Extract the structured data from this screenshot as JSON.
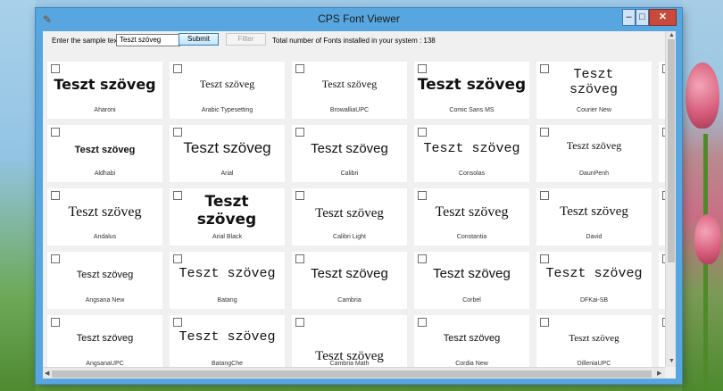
{
  "window": {
    "title": "CPS Font Viewer",
    "min_label": "0",
    "max_label": "1",
    "close_label": "r"
  },
  "toolbar": {
    "sample_label": "Enter the sample text :",
    "sample_value": "Teszt szöveg",
    "submit_label": "Submit",
    "filter_label": "Filter",
    "total_text": "Total number of Fonts installed in your system : 138"
  },
  "fonts": {
    "sample": "Teszt szöveg",
    "rows": [
      [
        {
          "name": "Aharoni"
        },
        {
          "name": "Arabic Typesetting"
        },
        {
          "name": "BrowalliaUPC"
        },
        {
          "name": "Comic Sans MS"
        },
        {
          "name": "Courier New"
        },
        {
          "name": ""
        }
      ],
      [
        {
          "name": "Aldhabi"
        },
        {
          "name": "Arial"
        },
        {
          "name": "Calibri"
        },
        {
          "name": "Consolas"
        },
        {
          "name": "DaunPenh"
        },
        {
          "name": ""
        }
      ],
      [
        {
          "name": "Andalus"
        },
        {
          "name": "Arial Black"
        },
        {
          "name": "Calibri Light"
        },
        {
          "name": "Constantia"
        },
        {
          "name": "David"
        },
        {
          "name": ""
        }
      ],
      [
        {
          "name": "Angsana New"
        },
        {
          "name": "Batang"
        },
        {
          "name": "Cambria"
        },
        {
          "name": "Corbel"
        },
        {
          "name": "DFKai-SB"
        },
        {
          "name": ""
        }
      ],
      [
        {
          "name": "AngsanaUPC"
        },
        {
          "name": "BatangChe"
        },
        {
          "name": "Cambria Math"
        },
        {
          "name": "Cordia New"
        },
        {
          "name": "DilleniaUPC"
        },
        {
          "name": ""
        }
      ]
    ]
  },
  "scroll": {
    "up": "▲",
    "down": "▼",
    "left": "◀",
    "right": "▶"
  }
}
